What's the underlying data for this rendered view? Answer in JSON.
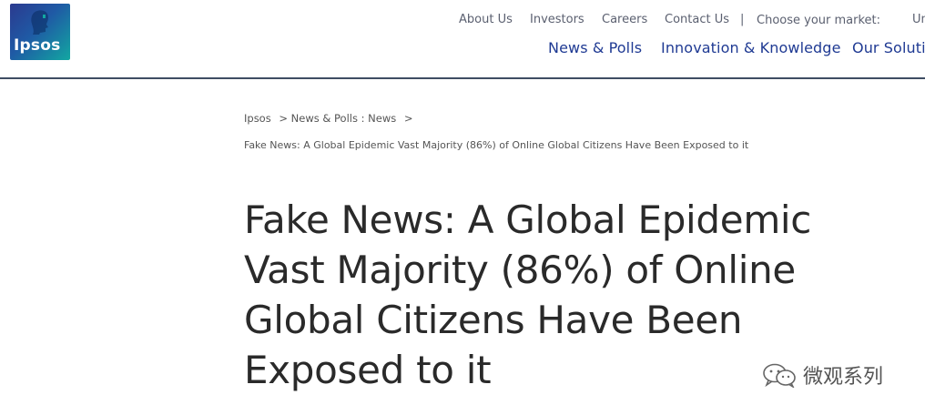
{
  "brand": {
    "logo_text": "Ipsos",
    "colors": {
      "primary": "#1f3a93",
      "logo_start": "#2b3a8f",
      "logo_end": "#12a7a1",
      "rule": "#3e4d63"
    }
  },
  "utility_nav": {
    "about": "About Us",
    "investors": "Investors",
    "careers": "Careers",
    "contact": "Contact Us",
    "separator": "|",
    "market_label": "Choose your market:",
    "market_value": "Un"
  },
  "main_nav": {
    "news_polls": "News & Polls",
    "innovation": "Innovation & Knowledge",
    "solutions": "Our Solutio"
  },
  "breadcrumb": {
    "home": "Ipsos",
    "sep1": ">",
    "section": "News & Polls : News",
    "sep2": ">",
    "current": "Fake News: A Global Epidemic Vast Majority (86%) of Online Global Citizens Have Been Exposed to it"
  },
  "article": {
    "headline_line1": "Fake News: A Global Epidemic",
    "headline_line2": "Vast Majority (86%) of Online",
    "headline_line3": "Global Citizens Have Been",
    "headline_line4": "Exposed to it"
  },
  "watermark": {
    "icon": "wechat-icon",
    "text": "微观系列"
  }
}
